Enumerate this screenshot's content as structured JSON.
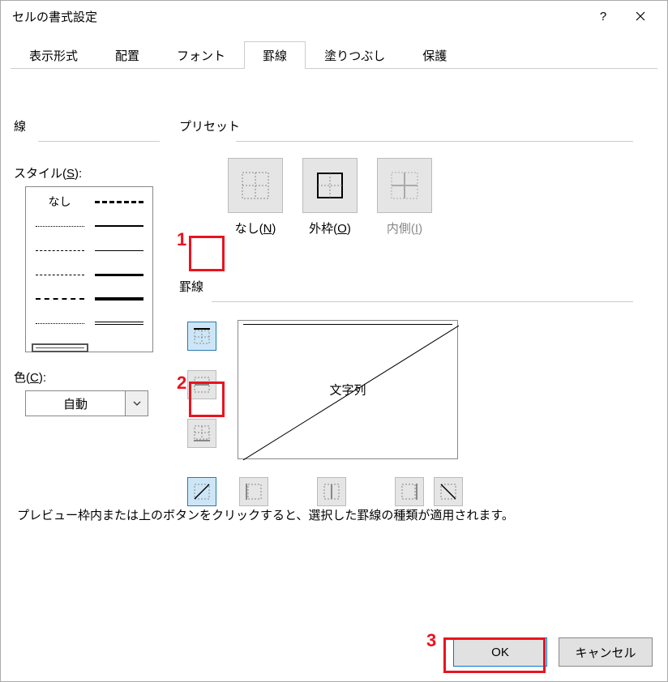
{
  "title": "セルの書式設定",
  "tabs": [
    "表示形式",
    "配置",
    "フォント",
    "罫線",
    "塗りつぶし",
    "保護"
  ],
  "active_tab": 3,
  "line_group": "線",
  "style_label": "スタイル(S):",
  "style_none": "なし",
  "color_label": "色(C):",
  "color_value": "自動",
  "preset_group": "プリセット",
  "presets": {
    "none": "なし(N)",
    "outer": "外枠(O)",
    "inner": "内側(I)"
  },
  "border_group": "罫線",
  "preview_text": "文字列",
  "hint": "プレビュー枠内または上のボタンをクリックすると、選択した罫線の種類が適用されます。",
  "ok": "OK",
  "cancel": "キャンセル",
  "annotations": {
    "a1": "1",
    "a2": "2",
    "a3": "3"
  }
}
